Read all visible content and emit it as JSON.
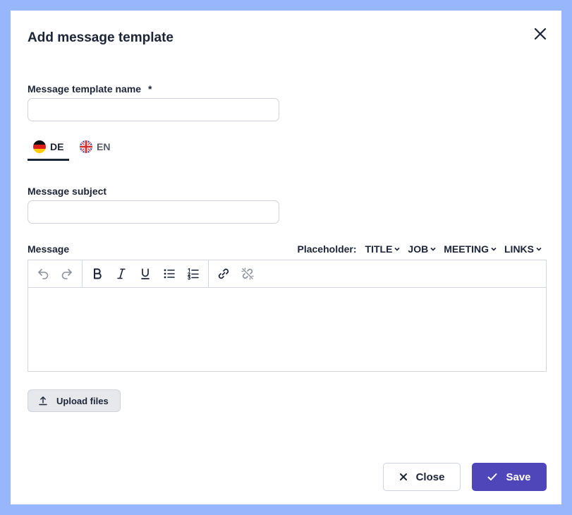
{
  "dialog": {
    "title": "Add message template"
  },
  "form": {
    "template_name": {
      "label": "Message template name",
      "required_marker": "*",
      "value": ""
    },
    "language_tabs": [
      {
        "code": "DE",
        "active": true
      },
      {
        "code": "EN",
        "active": false
      }
    ],
    "subject": {
      "label": "Message subject",
      "value": ""
    },
    "message": {
      "label": "Message",
      "placeholder_label": "Placeholder:",
      "placeholders": [
        "TITLE",
        "JOB",
        "MEETING",
        "LINKS"
      ],
      "toolbar_icons": [
        "undo-icon",
        "redo-icon",
        "bold-icon",
        "italic-icon",
        "underline-icon",
        "bullet-list-icon",
        "numbered-list-icon",
        "link-icon",
        "unlink-icon"
      ],
      "body": ""
    },
    "upload_label": "Upload files"
  },
  "footer": {
    "close_label": "Close",
    "save_label": "Save"
  },
  "colors": {
    "backdrop": "#97b6fb",
    "text": "#1c2437",
    "primary": "#4f46ba",
    "border": "#cfd3da",
    "icon_muted": "#8b919c"
  }
}
